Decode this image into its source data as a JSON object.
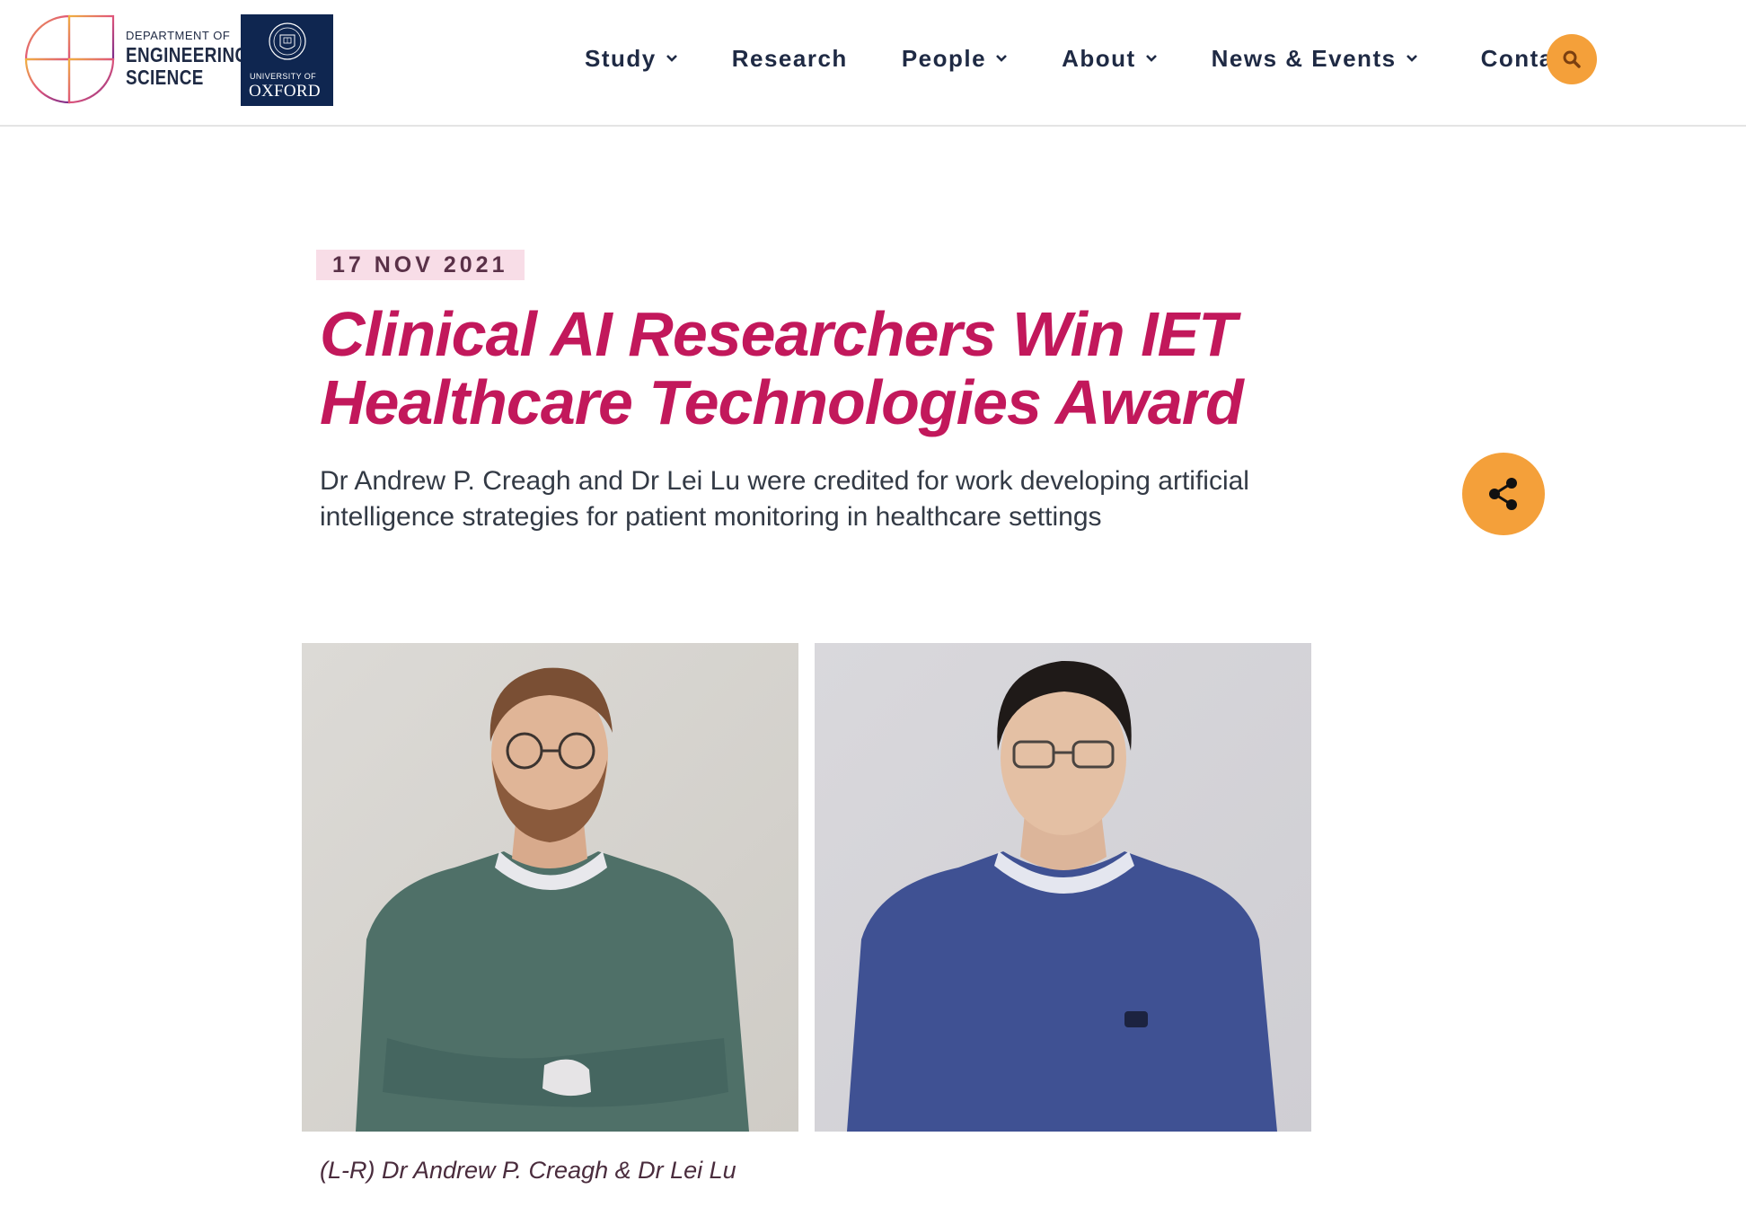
{
  "header": {
    "department": {
      "line1": "DEPARTMENT OF",
      "line2": "ENGINEERING",
      "line3": "SCIENCE"
    },
    "university": {
      "line1": "UNIVERSITY OF",
      "line2": "OXFORD"
    },
    "nav": [
      {
        "label": "Study",
        "has_dropdown": true
      },
      {
        "label": "Research",
        "has_dropdown": false
      },
      {
        "label": "People",
        "has_dropdown": true
      },
      {
        "label": "About",
        "has_dropdown": true
      },
      {
        "label": "News & Events",
        "has_dropdown": true
      },
      {
        "label": "Contact",
        "has_dropdown": false
      }
    ],
    "search_icon": "search-icon"
  },
  "article": {
    "date": "17 NOV 2021",
    "title": "Clinical AI Researchers Win IET Healthcare Technologies Award",
    "standfirst": "Dr Andrew P. Creagh and Dr Lei Lu were credited for work developing artificial intelligence strategies for patient monitoring in healthcare settings",
    "share_icon": "share-icon",
    "caption": "(L-R) Dr Andrew P. Creagh & Dr Lei Lu"
  },
  "colors": {
    "accent_orange": "#f4a03a",
    "title_magenta": "#c2185b",
    "navy": "#1f2a44",
    "date_badge_bg": "#f8dde7",
    "oxford_blue": "#0f2650"
  }
}
